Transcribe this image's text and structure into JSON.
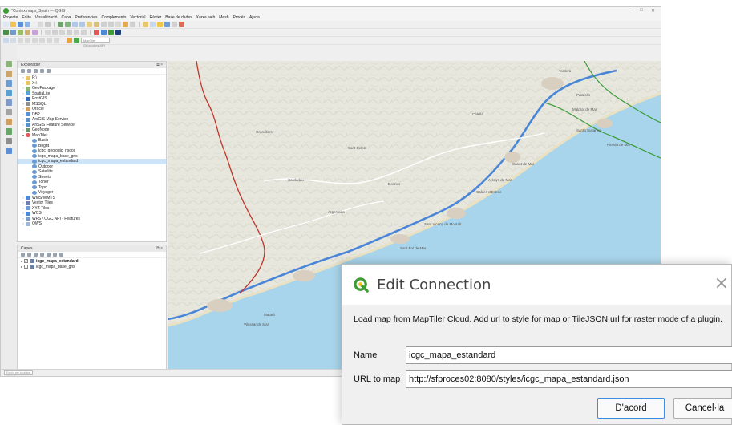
{
  "window": {
    "title": "*Contextmaps_Spain — QGIS",
    "menus": [
      "Projecte",
      "Edita",
      "Visualització",
      "Capa",
      "Preferències",
      "Complements",
      "Vectorial",
      "Ràster",
      "Base de dades",
      "Xarxa web",
      "Mesh",
      "Procés",
      "Ajuda"
    ]
  },
  "toolbar": {
    "search_placeholder": "MapTiler Geocoding API",
    "locator_placeholder": "Escriu per localitzar (Ctrl+K)"
  },
  "browser": {
    "title": "Explorador",
    "items": [
      {
        "label": "F:\\",
        "level": 0,
        "expanded": false,
        "icon": "folder-icon"
      },
      {
        "label": "X:\\",
        "level": 0,
        "expanded": false,
        "icon": "folder-icon"
      },
      {
        "label": "GeoPackage",
        "level": 0,
        "expanded": false,
        "icon": "geopackage-icon"
      },
      {
        "label": "SpatiaLite",
        "level": 0,
        "expanded": false,
        "icon": "spatialite-icon"
      },
      {
        "label": "PostGIS",
        "level": 0,
        "expanded": false,
        "icon": "postgis-icon"
      },
      {
        "label": "MSSQL",
        "level": 0,
        "expanded": false,
        "icon": "mssql-icon"
      },
      {
        "label": "Oracle",
        "level": 0,
        "expanded": false,
        "icon": "oracle-icon"
      },
      {
        "label": "DB2",
        "level": 0,
        "expanded": false,
        "icon": "db2-icon"
      },
      {
        "label": "ArcGIS Map Service",
        "level": 0,
        "expanded": false,
        "icon": "arcgis-icon"
      },
      {
        "label": "ArcGIS Feature Service",
        "level": 0,
        "expanded": false,
        "icon": "arcgis-icon"
      },
      {
        "label": "GeoNode",
        "level": 0,
        "expanded": false,
        "icon": "geonode-icon"
      },
      {
        "label": "MapTiler",
        "level": 0,
        "expanded": true,
        "icon": "maptiler-icon"
      },
      {
        "label": "Basic",
        "level": 1,
        "icon": "globe-icon"
      },
      {
        "label": "Bright",
        "level": 1,
        "icon": "globe-icon"
      },
      {
        "label": "icgc_geologic_riscos",
        "level": 1,
        "icon": "globe-icon"
      },
      {
        "label": "icgc_mapa_base_gris",
        "level": 1,
        "icon": "globe-icon"
      },
      {
        "label": "icgc_mapa_estandard",
        "level": 1,
        "icon": "globe-icon",
        "selected": true
      },
      {
        "label": "Outdoor",
        "level": 1,
        "icon": "globe-icon"
      },
      {
        "label": "Satellite",
        "level": 1,
        "icon": "globe-icon"
      },
      {
        "label": "Streets",
        "level": 1,
        "icon": "globe-icon"
      },
      {
        "label": "Toner",
        "level": 1,
        "icon": "globe-icon"
      },
      {
        "label": "Topo",
        "level": 1,
        "icon": "globe-icon"
      },
      {
        "label": "Voyager",
        "level": 1,
        "icon": "globe-icon"
      },
      {
        "label": "WMS/WMTS",
        "level": 0,
        "expanded": false,
        "icon": "wms-icon"
      },
      {
        "label": "Vector Tiles",
        "level": 0,
        "expanded": false,
        "icon": "vector-tiles-icon"
      },
      {
        "label": "XYZ Tiles",
        "level": 0,
        "expanded": false,
        "icon": "xyz-tiles-icon"
      },
      {
        "label": "WCS",
        "level": 0,
        "expanded": false,
        "icon": "wcs-icon"
      },
      {
        "label": "WFS / OGC API - Features",
        "level": 0,
        "expanded": false,
        "icon": "wfs-icon"
      },
      {
        "label": "OWS",
        "level": 0,
        "expanded": false,
        "icon": "ows-icon"
      }
    ]
  },
  "layers": {
    "title": "Capes",
    "items": [
      {
        "label": "icgc_mapa_estandard",
        "checked": true,
        "bold": true
      },
      {
        "label": "icgc_mapa_base_gris",
        "checked": false,
        "bold": false
      }
    ]
  },
  "map": {
    "place_labels": [
      "Tordera",
      "Palafolls",
      "Malgrat de Mar",
      "Santa Susanna",
      "Pineda de Mar",
      "Calella",
      "Canet de Mar",
      "Arenys de Mar",
      "Caldes d'Estrac",
      "Sant Vicenç de Montalt",
      "Sant Celoni",
      "Cardedeu",
      "Granollers",
      "Sant Pol de Mar",
      "Vilassar de Mar",
      "Mataró",
      "Argentona",
      "Dosrius"
    ]
  },
  "statusbar": {
    "search_placeholder": "Escriu per localitzar (Ctrl+K)"
  },
  "dialog": {
    "title": "Edit Connection",
    "description": "Load map from MapTiler Cloud. Add url to style for map or TileJSON url for raster mode of a plugin.",
    "name_label": "Name",
    "name_value": "icgc_mapa_estandard",
    "url_label": "URL to map",
    "url_value": "http://sfproces02:8080/styles/icgc_mapa_estandard.json",
    "ok_label": "D'acord",
    "cancel_label": "Cancel·la",
    "close_glyph": "×"
  },
  "colors": {
    "accent": "#3a8ee6",
    "route_blue": "#4a86d8",
    "route_red": "#c0352b",
    "route_green": "#3a9c3a",
    "sea": "#a9d5ec",
    "qgis_green": "#3e9c35"
  }
}
